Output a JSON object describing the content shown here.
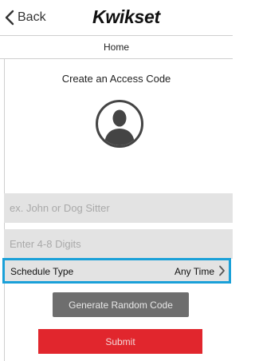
{
  "nav": {
    "back_label": "Back",
    "brand": "Kwikset"
  },
  "subheader": {
    "title": "Home"
  },
  "main": {
    "title": "Create an Access Code",
    "name_placeholder": "ex. John or Dog Sitter",
    "code_placeholder": "Enter 4-8 Digits",
    "schedule": {
      "label": "Schedule Type",
      "value": "Any Time"
    },
    "generate_label": "Generate Random Code",
    "submit_label": "Submit"
  },
  "icons": {
    "back": "chevron-left-icon",
    "avatar": "user-avatar-icon",
    "schedule": "chevron-right-icon"
  },
  "colors": {
    "highlight": "#1aa0d8",
    "submit": "#e1262d",
    "generate": "#6e6e6e",
    "field_bg": "#e3e3e3"
  }
}
